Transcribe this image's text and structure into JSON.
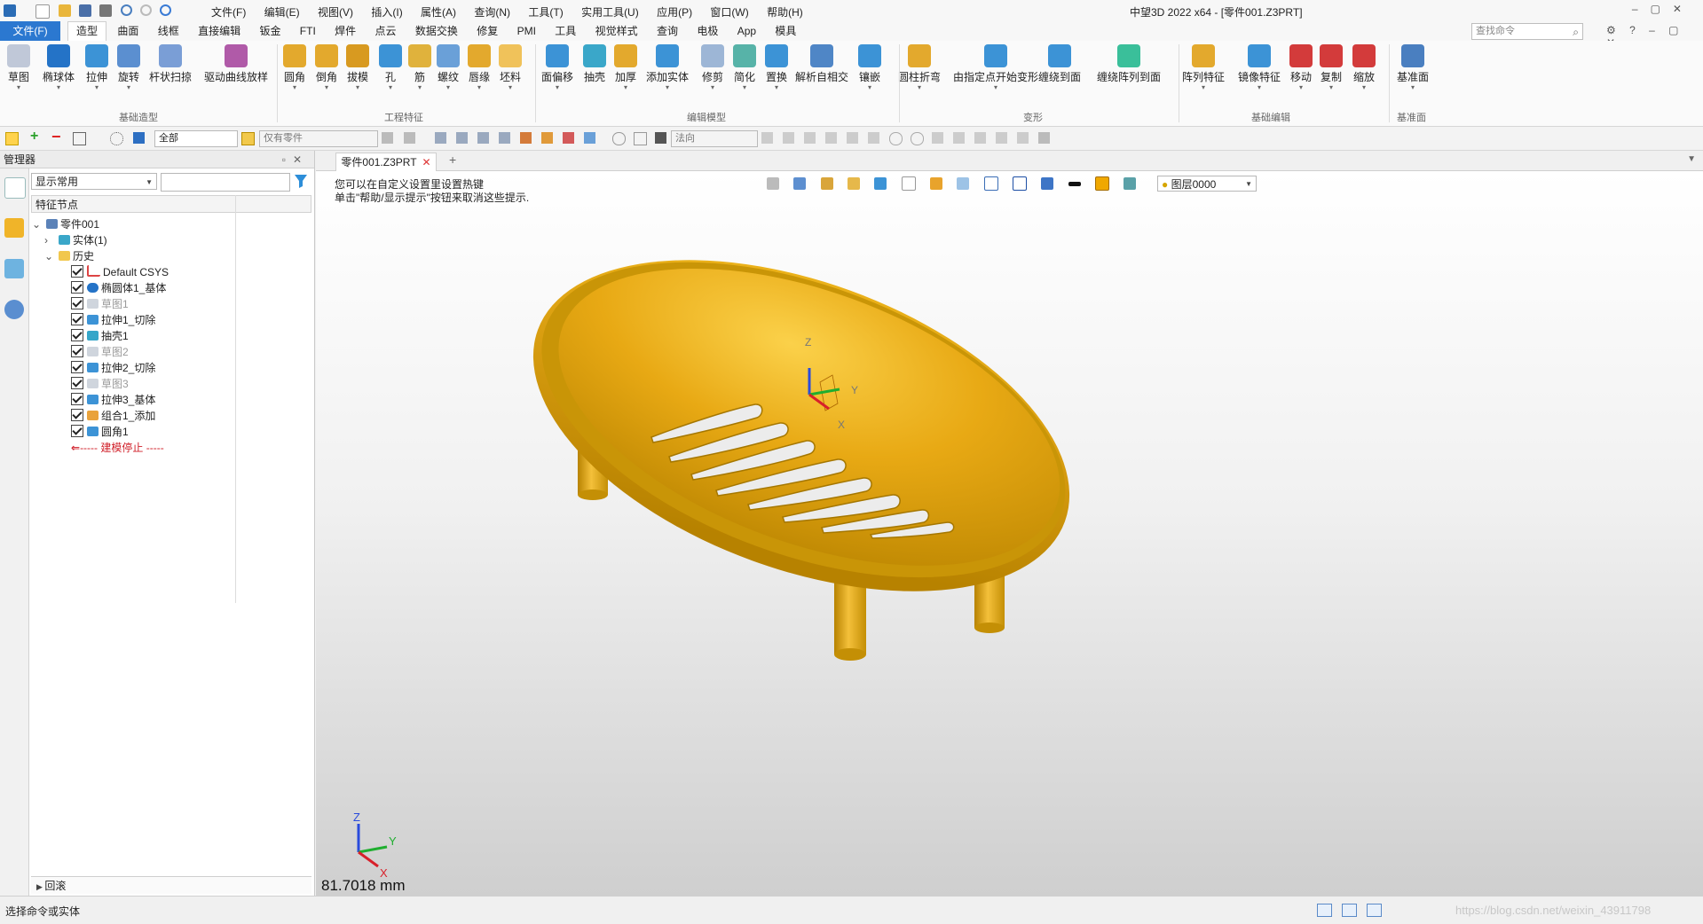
{
  "title_bar": {
    "window_title": "中望3D 2022 x64 - [零件001.Z3PRT]",
    "menu": [
      "文件(F)",
      "编辑(E)",
      "视图(V)",
      "插入(I)",
      "属性(A)",
      "查询(N)",
      "工具(T)",
      "实用工具(U)",
      "应用(P)",
      "窗口(W)",
      "帮助(H)"
    ]
  },
  "ribbon_tabs": {
    "file": "文件(F)",
    "tabs": [
      "造型",
      "曲面",
      "线框",
      "直接编辑",
      "钣金",
      "FTI",
      "焊件",
      "点云",
      "数据交换",
      "修复",
      "PMI",
      "工具",
      "视觉样式",
      "查询",
      "电极",
      "App",
      "模具"
    ],
    "active": "造型",
    "search_placeholder": "查找命令"
  },
  "ribbon": {
    "groups": [
      "基础造型",
      "工程特征",
      "编辑模型",
      "变形",
      "基础编辑",
      "基准面"
    ],
    "buttons": [
      "草图",
      "椭球体",
      "拉伸",
      "旋转",
      "杆状扫掠",
      "驱动曲线放样",
      "圆角",
      "倒角",
      "拔模",
      "孔",
      "筋",
      "螺纹",
      "唇缘",
      "坯料",
      "面偏移",
      "抽壳",
      "加厚",
      "添加实体",
      "修剪",
      "简化",
      "置换",
      "解析自相交",
      "镶嵌",
      "圆柱折弯",
      "由指定点开始变形",
      "缠绕到面",
      "缠绕阵列到面",
      "阵列特征",
      "镜像特征",
      "移动",
      "复制",
      "缩放",
      "基准面"
    ]
  },
  "toolbar": {
    "filter_all": "全部",
    "parts_only": "仅有零件",
    "direction": "法向"
  },
  "manager": {
    "title": "管理器",
    "display_mode": "显示常用",
    "tree_header": "特征节点",
    "tree": [
      {
        "label": "零件001",
        "icon": "part-icon"
      },
      {
        "label": "实体(1)",
        "icon": "solid-icon"
      },
      {
        "label": "历史",
        "icon": "folder-icon"
      },
      {
        "label": "Default CSYS",
        "icon": "csys-icon"
      },
      {
        "label": "椭圆体1_基体",
        "icon": "ellipsoid-icon"
      },
      {
        "label": "草图1",
        "icon": "sketch-icon"
      },
      {
        "label": "拉伸1_切除",
        "icon": "extrude-icon"
      },
      {
        "label": "抽壳1",
        "icon": "shell-icon"
      },
      {
        "label": "草图2",
        "icon": "sketch-icon"
      },
      {
        "label": "拉伸2_切除",
        "icon": "extrude-icon"
      },
      {
        "label": "草图3",
        "icon": "sketch-icon"
      },
      {
        "label": "拉伸3_基体",
        "icon": "extrude-icon"
      },
      {
        "label": "组合1_添加",
        "icon": "combine-icon"
      },
      {
        "label": "圆角1",
        "icon": "fillet-icon"
      },
      {
        "label": "----- 建模停止 -----",
        "icon": "stop-arrow-icon"
      }
    ],
    "rollback": "回滚"
  },
  "document": {
    "tab": "零件001.Z3PRT",
    "hint_line1": "您可以在自定义设置里设置热键",
    "hint_line2": "单击\"帮助/显示提示\"按钮来取消这些提示.",
    "layer": "图层0000",
    "scale": "81.7018 mm",
    "axis_x": "X",
    "axis_y": "Y",
    "axis_z": "Z"
  },
  "status": {
    "text": "选择命令或实体",
    "watermark": "https://blog.csdn.net/weixin_43911798"
  },
  "colors": {
    "model": "#e8a914",
    "accent": "#2b78d0"
  }
}
